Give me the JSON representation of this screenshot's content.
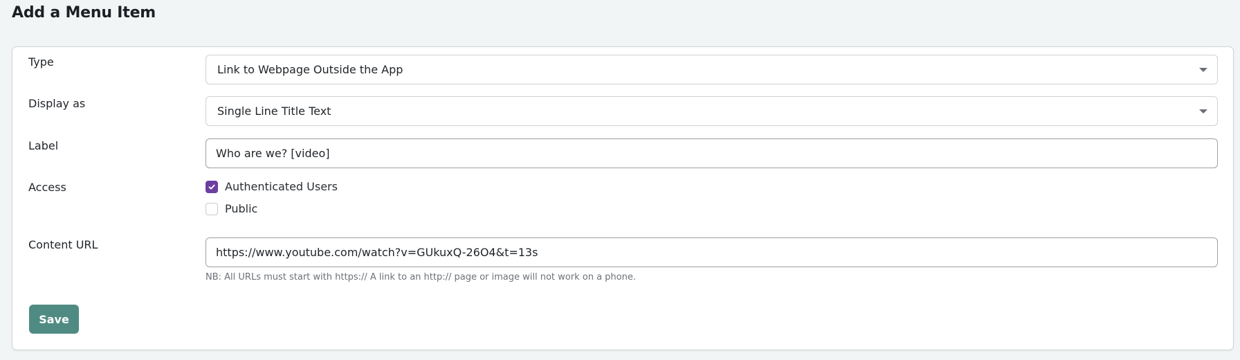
{
  "page": {
    "title": "Add a Menu Item"
  },
  "form": {
    "type": {
      "label": "Type",
      "value": "Link to Webpage Outside the App"
    },
    "display_as": {
      "label": "Display as",
      "value": "Single Line Title Text"
    },
    "label_field": {
      "label": "Label",
      "value": "Who are we? [video]"
    },
    "access": {
      "label": "Access",
      "options": [
        {
          "label": "Authenticated Users",
          "checked": true
        },
        {
          "label": "Public",
          "checked": false
        }
      ]
    },
    "content_url": {
      "label": "Content URL",
      "value": "https://www.youtube.com/watch?v=GUkuxQ-26O4&t=13s",
      "hint": "NB: All URLs must start with https:// A link to an http:// page or image will not work on a phone."
    },
    "save_label": "Save"
  },
  "colors": {
    "accent": "#6b3fa0",
    "button": "#4f8b83"
  }
}
